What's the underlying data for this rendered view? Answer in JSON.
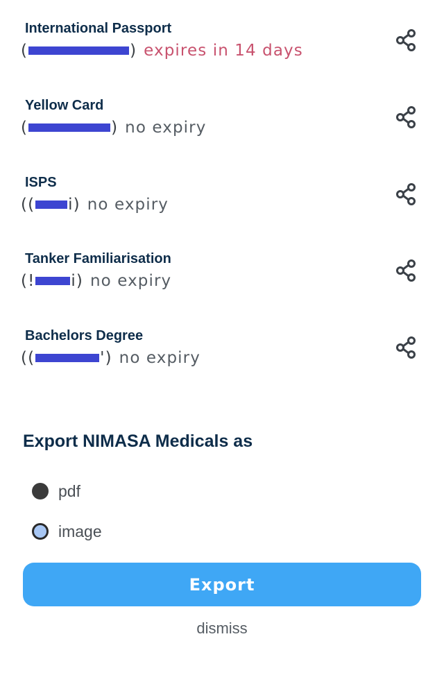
{
  "documents": [
    {
      "title": "International Passport",
      "id_open": "(",
      "id_close": ") ",
      "expiry": "expires in 14 days",
      "expiry_color": "#c8526e"
    },
    {
      "title": "Yellow Card",
      "id_open": "(",
      "id_close": ")",
      "expiry": "no expiry"
    },
    {
      "title": "ISPS",
      "id_open": "((",
      "id_close": "i)",
      "expiry": "no expiry"
    },
    {
      "title": "Tanker Familiarisation",
      "id_open": "(!",
      "id_close": "i)",
      "expiry": "no expiry"
    },
    {
      "title": "Bachelors Degree",
      "id_open": "((",
      "id_close": "')",
      "expiry": "no expiry"
    }
  ],
  "export": {
    "heading": "Export NIMASA Medicals as",
    "options": [
      {
        "label": "pdf",
        "selected": false
      },
      {
        "label": "image",
        "selected": true
      }
    ],
    "button_label": "Export",
    "dismiss_label": "dismiss"
  },
  "colors": {
    "accent": "#3fa7f5",
    "title": "#0e2d4a",
    "warning": "#c8526e",
    "redaction": "#3d45d1"
  }
}
